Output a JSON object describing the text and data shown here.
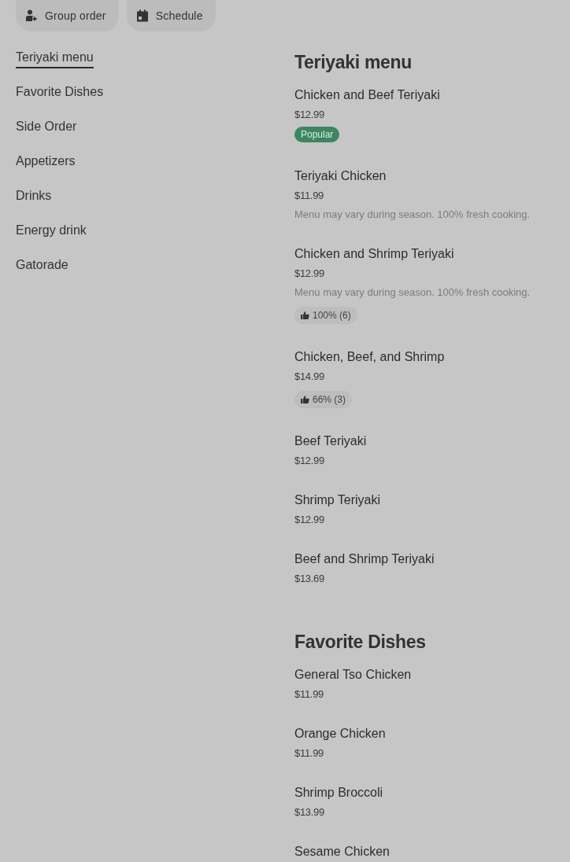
{
  "actions": [
    {
      "kind": "group",
      "label": "Group order"
    },
    {
      "kind": "schedule",
      "label": "Schedule"
    }
  ],
  "nav": {
    "items": [
      {
        "label": "Teriyaki menu",
        "selected": true
      },
      {
        "label": "Favorite Dishes",
        "selected": false
      },
      {
        "label": "Side Order",
        "selected": false
      },
      {
        "label": "Appetizers",
        "selected": false
      },
      {
        "label": "Drinks",
        "selected": false
      },
      {
        "label": "Energy drink",
        "selected": false
      },
      {
        "label": "Gatorade",
        "selected": false
      }
    ]
  },
  "sections": [
    {
      "title": "Teriyaki menu",
      "items": [
        {
          "name": "Chicken and Beef Teriyaki",
          "price": "$12.99",
          "tags": [
            {
              "kind": "popular",
              "text": "Popular"
            }
          ]
        },
        {
          "name": "Teriyaki Chicken",
          "price": "$11.99",
          "description": "Menu may vary during season. 100% fresh cooking."
        },
        {
          "name": "Chicken and Shrimp Teriyaki",
          "price": "$12.99",
          "description": "Menu may vary during season. 100% fresh cooking.",
          "tags": [
            {
              "kind": "rating",
              "text": "100% (6)"
            }
          ]
        },
        {
          "name": "Chicken, Beef, and Shrimp",
          "price": "$14.99",
          "tags": [
            {
              "kind": "rating",
              "text": "66% (3)"
            }
          ]
        },
        {
          "name": "Beef Teriyaki",
          "price": "$12.99"
        },
        {
          "name": "Shrimp Teriyaki",
          "price": "$12.99"
        },
        {
          "name": "Beef and Shrimp Teriyaki",
          "price": "$13.69"
        }
      ]
    },
    {
      "title": "Favorite Dishes",
      "items": [
        {
          "name": "General Tso Chicken",
          "price": "$11.99"
        },
        {
          "name": "Orange Chicken",
          "price": "$11.99"
        },
        {
          "name": "Shrimp Broccoli",
          "price": "$13.99"
        },
        {
          "name": "Sesame Chicken"
        }
      ]
    }
  ]
}
